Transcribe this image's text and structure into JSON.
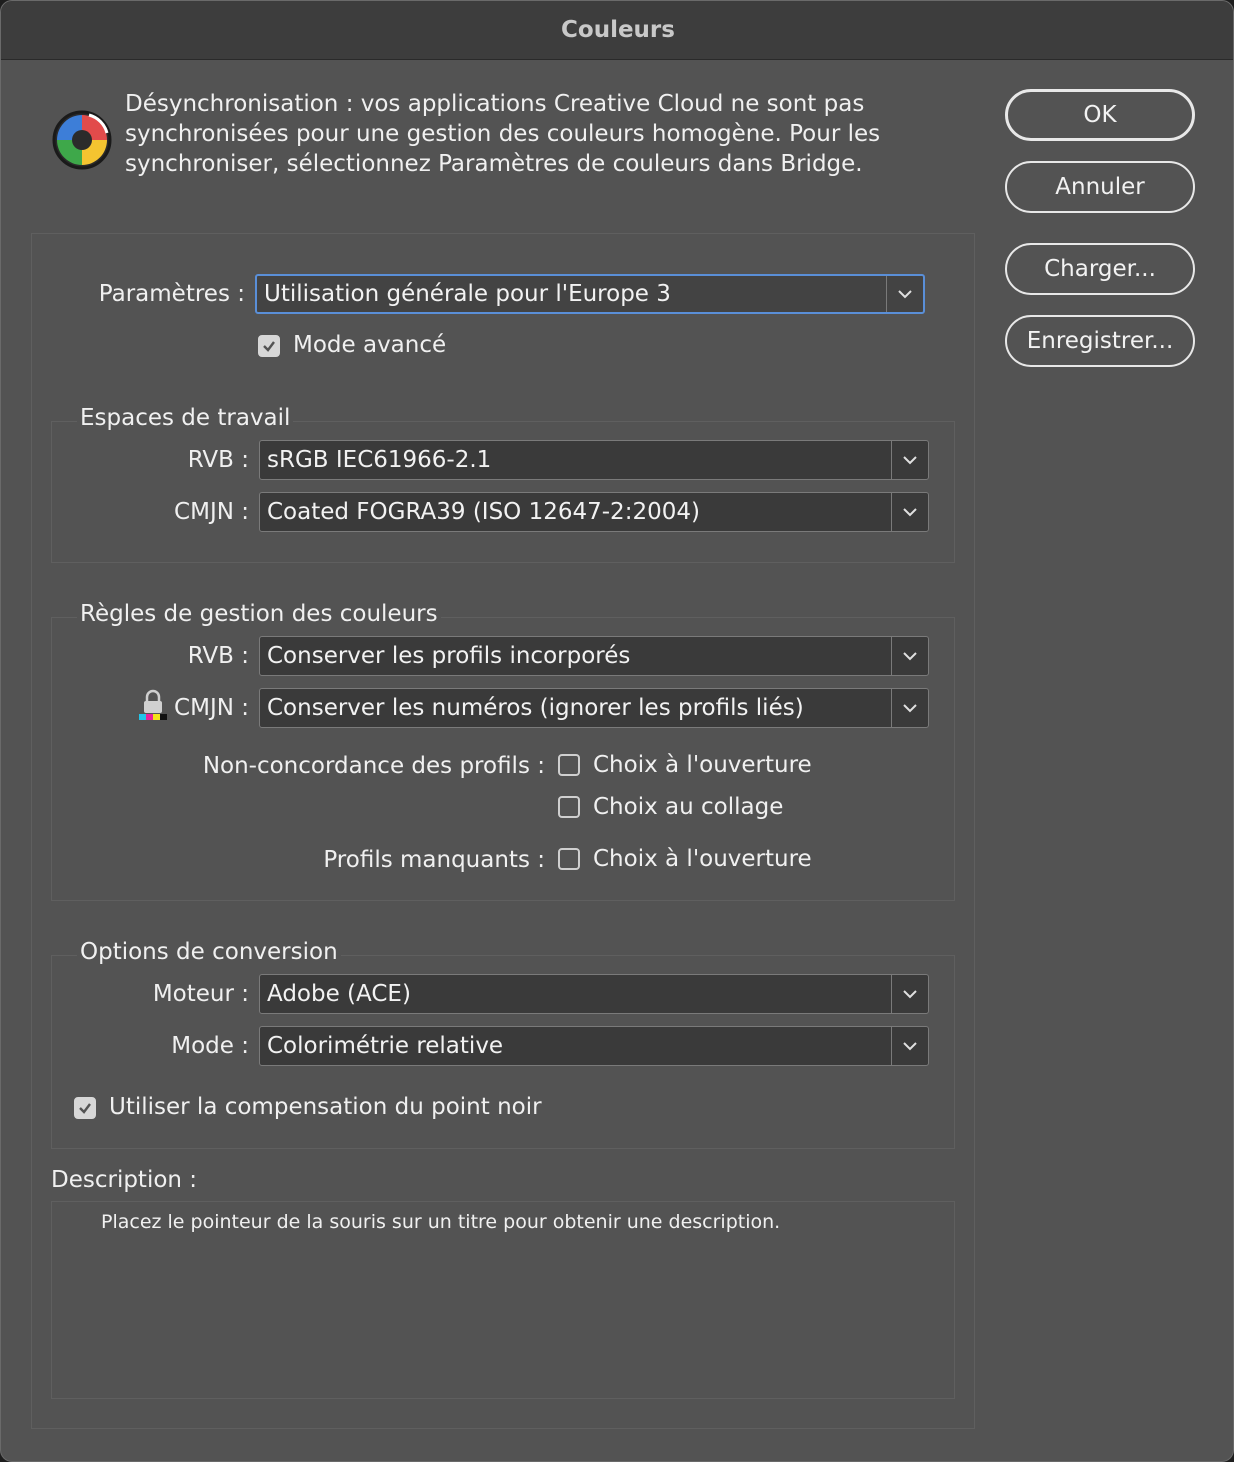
{
  "window": {
    "title": "Couleurs"
  },
  "warning": {
    "icon": "color-sync-icon",
    "text": "Désynchronisation : vos applications Creative Cloud ne sont pas synchronisées pour une gestion des couleurs homogène. Pour les synchroniser, sélectionnez Paramètres de couleurs dans Bridge."
  },
  "buttons": {
    "ok": "OK",
    "cancel": "Annuler",
    "load": "Charger...",
    "save": "Enregistrer..."
  },
  "settings": {
    "label": "Paramètres :",
    "value": "Utilisation générale pour l'Europe 3",
    "advanced_label": "Mode avancé",
    "advanced_checked": true
  },
  "working_spaces": {
    "title": "Espaces de travail",
    "rgb_label": "RVB :",
    "rgb_value": "sRGB IEC61966-2.1",
    "cmyk_label": "CMJN :",
    "cmyk_value": "Coated FOGRA39 (ISO 12647-2:2004)"
  },
  "policies": {
    "title": "Règles de gestion des couleurs",
    "rgb_label": "RVB :",
    "rgb_value": "Conserver les profils incorporés",
    "cmyk_label": "CMJN :",
    "cmyk_value": "Conserver les numéros (ignorer les profils liés)",
    "mismatch_label": "Non-concordance des profils :",
    "ask_open_label": "Choix à l'ouverture",
    "ask_paste_label": "Choix au collage",
    "missing_label": "Profils manquants :",
    "missing_ask_open_label": "Choix à l'ouverture"
  },
  "conversion": {
    "title": "Options de conversion",
    "engine_label": "Moteur :",
    "engine_value": "Adobe (ACE)",
    "intent_label": "Mode :",
    "intent_value": "Colorimétrie relative",
    "bpc_label": "Utiliser la compensation du point noir",
    "bpc_checked": true
  },
  "description": {
    "title": "Description :",
    "text": "Placez le pointeur de la souris sur un titre pour obtenir une description."
  }
}
